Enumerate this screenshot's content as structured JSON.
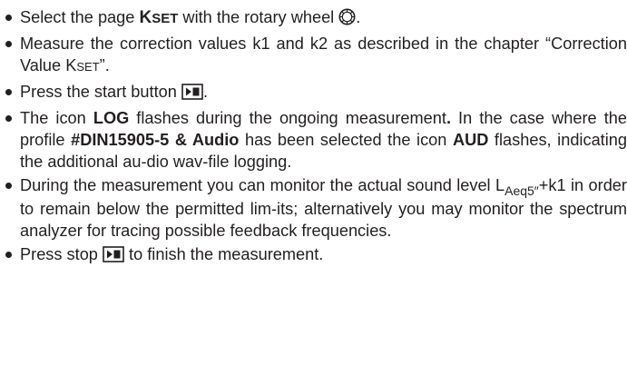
{
  "items": [
    {
      "pre": "Select the page ",
      "kset": "KSET",
      "mid": " with the rotary wheel ",
      "post": ".",
      "icon": "rotary-wheel-icon"
    },
    {
      "text": "Measure the correction values k1 and k2 as described in the chapter “Correction Value K",
      "kset_suffix": "SET",
      "end": "”."
    },
    {
      "pre": "Press the start button ",
      "post": ".",
      "icon": "start-stop-button-icon"
    },
    {
      "p1": "The icon ",
      "b1": "LOG",
      "p2": " flashes during the ongoing measurement",
      "b2": ".",
      "p3": " In the case where the profile ",
      "b3": "#DIN15905-5 & Audio",
      "p4": " has been selected the icon ",
      "b4": "AUD",
      "p5": " flashes, indicating the additional au-dio wav-file logging."
    },
    {
      "p1": "During the measurement you can monitor the actual sound level L",
      "sub": "Aeq5″",
      "p2": "+k1 in order to remain below the permitted lim-its; alternatively you may monitor the spectrum analyzer for tracing possible feedback frequencies."
    },
    {
      "pre": "Press stop ",
      "post": " to finish the measurement.",
      "icon": "start-stop-button-icon"
    }
  ]
}
